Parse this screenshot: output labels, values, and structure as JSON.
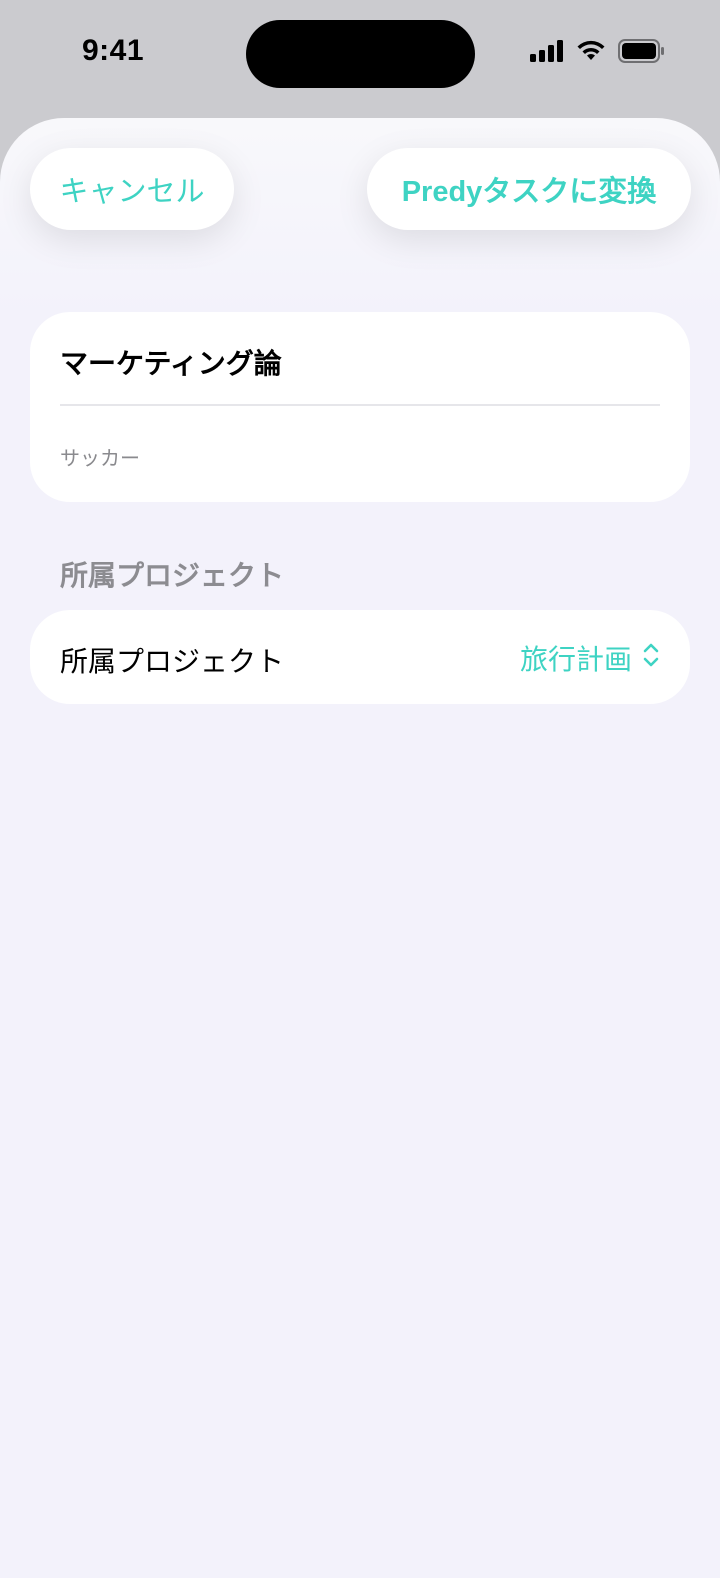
{
  "status_bar": {
    "time": "9:41",
    "icons": [
      "signal-icon",
      "wifi-icon",
      "battery-icon"
    ]
  },
  "toolbar": {
    "cancel_label": "キャンセル",
    "convert_label": "Predyタスクに変換"
  },
  "task": {
    "title": "マーケティング論",
    "note": "サッカー"
  },
  "project_section": {
    "header": "所属プロジェクト",
    "row_label": "所属プロジェクト",
    "selected_value": "旅行計画",
    "icon": "chevron-up-down-icon"
  },
  "colors": {
    "accent": "#3ed3c3",
    "background": "#f3f2fb",
    "card": "#ffffff",
    "secondary_text": "#8c8c91"
  }
}
